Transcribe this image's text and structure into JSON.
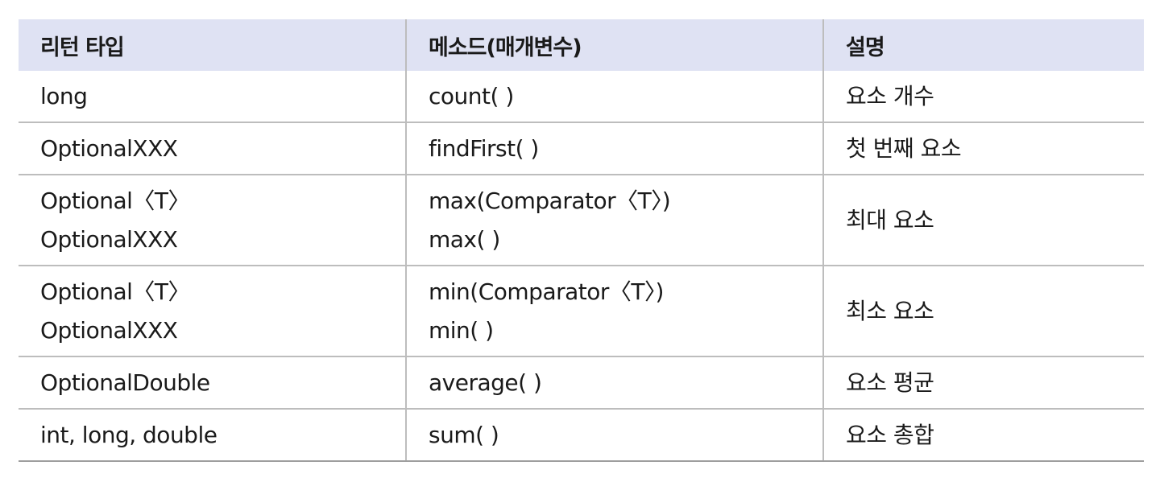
{
  "headers": {
    "return_type": "리턴 타입",
    "method": "메소드(매개변수)",
    "description": "설명"
  },
  "rows": [
    {
      "return_type": [
        "long"
      ],
      "method": [
        "count( )"
      ],
      "description": "요소 개수"
    },
    {
      "return_type": [
        "OptionalXXX"
      ],
      "method": [
        "findFirst( )"
      ],
      "description": "첫 번째 요소"
    },
    {
      "return_type": [
        "Optional〈T〉",
        "OptionalXXX"
      ],
      "method": [
        "max(Comparator〈T〉)",
        "max( )"
      ],
      "description": "최대 요소"
    },
    {
      "return_type": [
        "Optional〈T〉",
        "OptionalXXX"
      ],
      "method": [
        "min(Comparator〈T〉)",
        "min( )"
      ],
      "description": "최소 요소"
    },
    {
      "return_type": [
        "OptionalDouble"
      ],
      "method": [
        "average( )"
      ],
      "description": "요소 평균"
    },
    {
      "return_type": [
        "int, long, double"
      ],
      "method": [
        "sum( )"
      ],
      "description": "요소 총합"
    }
  ],
  "colors": {
    "header_bg": "#dfe2f3",
    "border": "#bdbdbd"
  }
}
